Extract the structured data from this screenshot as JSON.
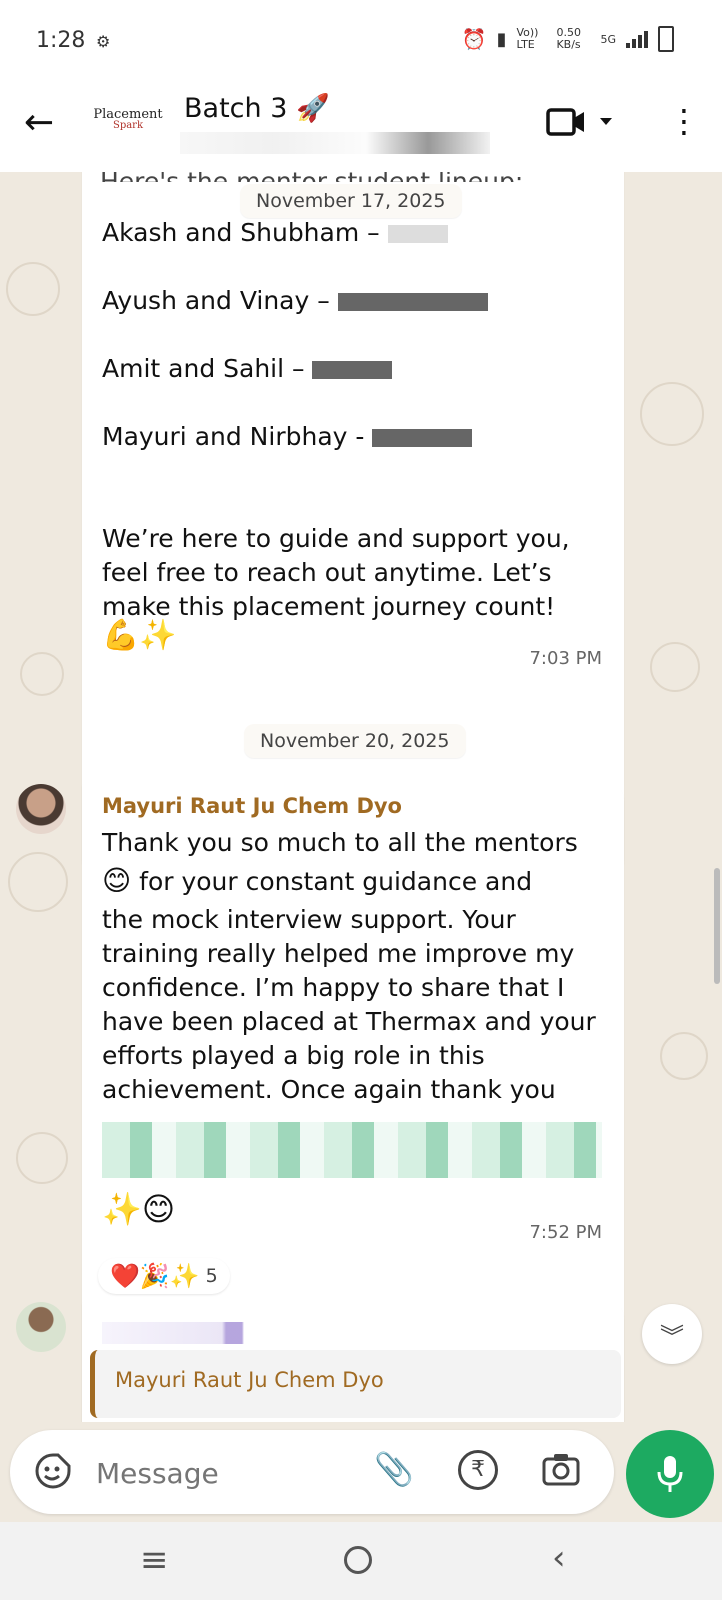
{
  "status_bar": {
    "time": "1:28",
    "volte": "Vo)) LTE",
    "speed": "0.50 KB/s",
    "network": "5G"
  },
  "header": {
    "logo_line1": "Placement",
    "logo_line2": "Spark",
    "title": "Batch 3",
    "title_emoji": "🚀"
  },
  "chat": {
    "date_chip_1": "November 17, 2025",
    "partial_header": "Here's the mentor-student lineup:",
    "message1": {
      "lines": [
        "Akash and Shubham –",
        "Ayush and Vinay –",
        "Amit and Sahil –",
        "Mayuri and Nirbhay  -"
      ],
      "closing": "We’re here to guide and support you, feel free to reach out anytime. Let’s make this placement journey count!",
      "emoji": "💪✨",
      "time": "7:03 PM"
    },
    "date_chip_2": "November 20, 2025",
    "message2": {
      "sender": "Mayuri Raut Ju Chem Dyo",
      "text_line1": "Thank you so much to all the mentors",
      "text_emoji": "😊",
      "text_line2": " for your constant guidance and",
      "text_rest": "the mock interview support. Your training really helped me improve my confidence. I’m happy to share that I have been placed at Thermax and your efforts played a big role in this achievement. Once again thank you",
      "end_emoji": "✨😊",
      "time": "7:52 PM",
      "reactions": "❤️🎉✨",
      "reaction_count": "5"
    },
    "message3": {
      "quoted_sender": "Mayuri Raut Ju Chem Dyo"
    }
  },
  "input": {
    "placeholder": "Message"
  },
  "colors": {
    "accent_green": "#1daa61",
    "sender_color": "#a06a22",
    "chat_bg": "#efe9df"
  }
}
